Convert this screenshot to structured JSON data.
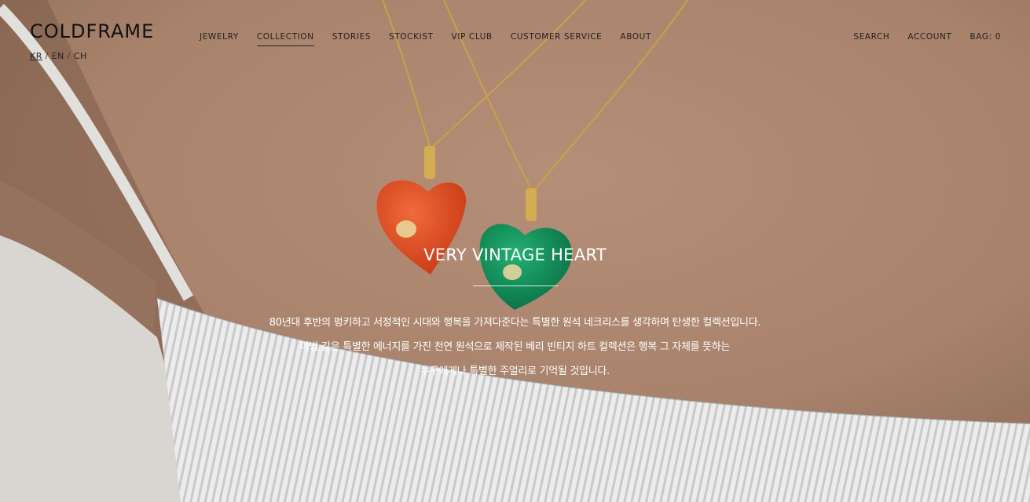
{
  "brand": {
    "name": "COLDFRAME"
  },
  "languages": [
    {
      "label": "KR",
      "active": true
    },
    {
      "label": "EN",
      "active": false
    },
    {
      "label": "CH",
      "active": false
    }
  ],
  "lang_separator": "/",
  "nav": {
    "items": [
      {
        "label": "JEWELRY"
      },
      {
        "label": "COLLECTION"
      },
      {
        "label": "STORIES"
      },
      {
        "label": "STOCKIST"
      },
      {
        "label": "VIP CLUB"
      },
      {
        "label": "CUSTOMER SERVICE"
      },
      {
        "label": "ABOUT"
      }
    ]
  },
  "util": {
    "search": "SEARCH",
    "account": "ACCOUNT",
    "bag": "BAG: 0"
  },
  "hero": {
    "title": "VERY VINTAGE HEART",
    "lines": [
      "80년대 후반의 펑키하고 서정적인 시대와 행복을 가져다준다는 특별한 원석 네크리스를 생각하며 탄생한 컬렉션입니다.",
      "마법 같은 특별한 에너지를 가진 천연 원석으로 제작된 베리 빈티지 하트 컬렉션은 행복 그 자체를 뜻하는",
      "누구에게나 특별한 주얼리로 기억될 것입니다."
    ],
    "colors": {
      "skin": "#b08a73",
      "red_heart": "#d9461f",
      "green_heart": "#0f8a55",
      "chain": "#c9a24a",
      "fabric": "#e6e6e6"
    }
  }
}
